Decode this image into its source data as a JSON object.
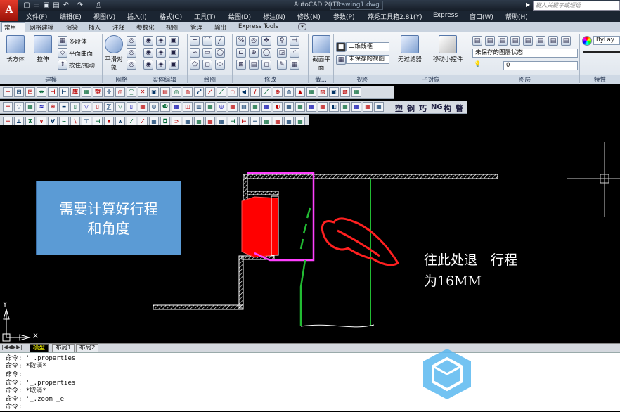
{
  "app": {
    "logo_letter": "A",
    "title": "AutoCAD 2010",
    "file": "Drawing1.dwg",
    "search_placeholder": "键入关键字或短语"
  },
  "menu": [
    "文件(F)",
    "编辑(E)",
    "视图(V)",
    "插入(I)",
    "格式(O)",
    "工具(T)",
    "绘图(D)",
    "标注(N)",
    "修改(M)",
    "参数(P)",
    "燕秀工具箱2.81(Y)",
    "Express",
    "窗口(W)",
    "帮助(H)"
  ],
  "tabs": [
    "常用",
    "网格建模",
    "渲染",
    "插入",
    "注释",
    "参数化",
    "视图",
    "管理",
    "输出",
    "Express Tools"
  ],
  "ribbon": {
    "box_label": "长方体",
    "extrude_label": "拉伸",
    "polysolid": "多段体",
    "planar": "平面曲面",
    "presspull": "按住/拖动",
    "smooth_label": "平滑对象",
    "section_label": "截面平面",
    "visual_style": "二维线框",
    "view_state": "未保存的视图",
    "filter_label": "无过滤器",
    "gizmo_label": "移动小控件",
    "layer_state": "未保存的图层状态",
    "layer_name": "0",
    "bylayer": "ByLay",
    "panels": [
      "建模",
      "网格",
      "实体编辑",
      "绘图",
      "修改",
      "截...",
      "视图",
      "子对象",
      "图层",
      "特性"
    ]
  },
  "toolbar3_text": [
    "塑",
    "钢",
    "巧",
    "NG",
    "构",
    "警"
  ],
  "canvas": {
    "note_box": [
      "需要计算好行程",
      "和角度"
    ],
    "annotation": [
      "往此处退　行程",
      "为16MM"
    ],
    "axis_y": "Y",
    "axis_x": "X"
  },
  "layout_tabs": [
    "模型",
    "布局1",
    "布局2"
  ],
  "commands": [
    "命令: '_.properties",
    "命令: *取消*",
    "命令:",
    "命令: '_.properties",
    "命令: *取消*",
    "命令: '_.zoom _e",
    "命令:"
  ],
  "colors": {
    "magenta": "#ff40ff",
    "green": "#22bb33",
    "red": "#ff0000",
    "note_blue": "#5b9bd5"
  }
}
